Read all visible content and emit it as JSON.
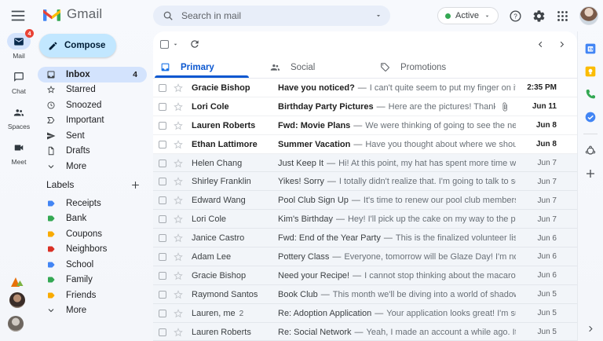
{
  "brand": {
    "name": "Gmail"
  },
  "topbar": {
    "search_placeholder": "Search in mail",
    "status_label": "Active",
    "icons": [
      "search-icon",
      "dropdown-caret-icon",
      "help-icon",
      "settings-icon",
      "apps-grid-icon",
      "account-avatar"
    ]
  },
  "left_rail": {
    "items": [
      {
        "label": "Mail",
        "icon": "mail",
        "badge": "4",
        "active": true
      },
      {
        "label": "Chat",
        "icon": "chat",
        "active": false
      },
      {
        "label": "Spaces",
        "icon": "spaces",
        "active": false
      },
      {
        "label": "Meet",
        "icon": "meet",
        "active": false
      }
    ]
  },
  "sidebar": {
    "compose_label": "Compose",
    "items": [
      {
        "label": "Inbox",
        "icon": "inbox",
        "count": "4",
        "active": true
      },
      {
        "label": "Starred",
        "icon": "star",
        "active": false
      },
      {
        "label": "Snoozed",
        "icon": "clock",
        "active": false
      },
      {
        "label": "Important",
        "icon": "important",
        "active": false
      },
      {
        "label": "Sent",
        "icon": "send",
        "active": false
      },
      {
        "label": "Drafts",
        "icon": "draft",
        "active": false
      },
      {
        "label": "More",
        "icon": "chevron-down",
        "active": false
      }
    ],
    "labels_title": "Labels",
    "labels": [
      {
        "name": "Receipts",
        "color": "#4285f4"
      },
      {
        "name": "Bank",
        "color": "#34a853"
      },
      {
        "name": "Coupons",
        "color": "#f9ab00"
      },
      {
        "name": "Neighbors",
        "color": "#d93025"
      },
      {
        "name": "School",
        "color": "#4285f4"
      },
      {
        "name": "Family",
        "color": "#34a853"
      },
      {
        "name": "Friends",
        "color": "#f9ab00"
      }
    ],
    "labels_more": "More"
  },
  "tabs": [
    {
      "label": "Primary",
      "icon": "tab-primary",
      "active": true
    },
    {
      "label": "Social",
      "icon": "tab-social",
      "active": false
    },
    {
      "label": "Promotions",
      "icon": "tab-promotions",
      "active": false
    }
  ],
  "list": {
    "separator": "—"
  },
  "emails": [
    {
      "sender": "Gracie Bishop",
      "subject": "Have you noticed?",
      "snippet": "I can't quite seem to put my finger on it, but somethin...",
      "date": "2:35 PM",
      "unread": true,
      "attachment": false
    },
    {
      "sender": "Lori Cole",
      "subject": "Birthday Party Pictures",
      "snippet": "Here are the pictures! Thanks so much for helpi...",
      "date": "Jun 11",
      "unread": true,
      "attachment": true
    },
    {
      "sender": "Lauren Roberts",
      "subject": "Fwd: Movie Plans",
      "snippet": "We were thinking of going to see the new Top Gun mo...",
      "date": "Jun 8",
      "unread": true,
      "attachment": false
    },
    {
      "sender": "Ethan Lattimore",
      "subject": "Summer Vacation",
      "snippet": "Have you thought about where we should go this sum...",
      "date": "Jun 8",
      "unread": true,
      "attachment": false
    },
    {
      "sender": "Helen Chang",
      "subject": "Just Keep It",
      "snippet": "Hi! At this point, my hat has spent more time with you than w...",
      "date": "Jun 7",
      "unread": false,
      "attachment": false
    },
    {
      "sender": "Shirley Franklin",
      "subject": "Yikes! Sorry",
      "snippet": "I totally didn't realize that. I'm going to talk to some people a...",
      "date": "Jun 7",
      "unread": false,
      "attachment": false
    },
    {
      "sender": "Edward Wang",
      "subject": "Pool Club Sign Up",
      "snippet": "It's time to renew our pool club membership. Do you re...",
      "date": "Jun 7",
      "unread": false,
      "attachment": false
    },
    {
      "sender": "Lori Cole",
      "subject": "Kim's Birthday",
      "snippet": "Hey! I'll pick up the cake on my way to the party. Do you th...",
      "date": "Jun 7",
      "unread": false,
      "attachment": false
    },
    {
      "sender": "Janice Castro",
      "subject": "Fwd: End of the Year Party",
      "snippet": "This is the finalized volunteer list for the end of...",
      "date": "Jun 6",
      "unread": false,
      "attachment": false
    },
    {
      "sender": "Adam Lee",
      "subject": "Pottery Class",
      "snippet": "Everyone, tomorrow will be Glaze Day! I'm not talking about...",
      "date": "Jun 6",
      "unread": false,
      "attachment": false
    },
    {
      "sender": "Gracie Bishop",
      "subject": "Need your Recipe!",
      "snippet": "I cannot stop thinking about the macaroni and cheese...",
      "date": "Jun 6",
      "unread": false,
      "attachment": false
    },
    {
      "sender": "Raymond Santos",
      "subject": "Book Club",
      "snippet": "This month we'll be diving into a world of shadows in Holly Bla...",
      "date": "Jun 5",
      "unread": false,
      "attachment": false
    },
    {
      "sender": "Lauren, me",
      "thread_count": "2",
      "subject": "Re: Adoption Application",
      "snippet": "Your application looks great! I'm sure Otto would...",
      "date": "Jun 5",
      "unread": false,
      "attachment": false
    },
    {
      "sender": "Lauren Roberts",
      "subject": "Re: Social Network",
      "snippet": "Yeah, I made an account a while ago. It's like radio but...",
      "date": "Jun 5",
      "unread": false,
      "attachment": false
    }
  ],
  "right_rail": {
    "apps": [
      "calendar",
      "keep",
      "voice",
      "tasks"
    ],
    "addons": [
      "addon",
      "plus"
    ]
  },
  "colors": {
    "accent_blue": "#0b57d0",
    "compose_bg": "#c2e7ff",
    "selected_bg": "#d3e3fd",
    "badge_red": "#e94235",
    "active_dot_green": "#34a853",
    "label_blue": "#4285f4",
    "label_green": "#34a853",
    "label_yellow": "#f9ab00",
    "label_red": "#d93025"
  }
}
